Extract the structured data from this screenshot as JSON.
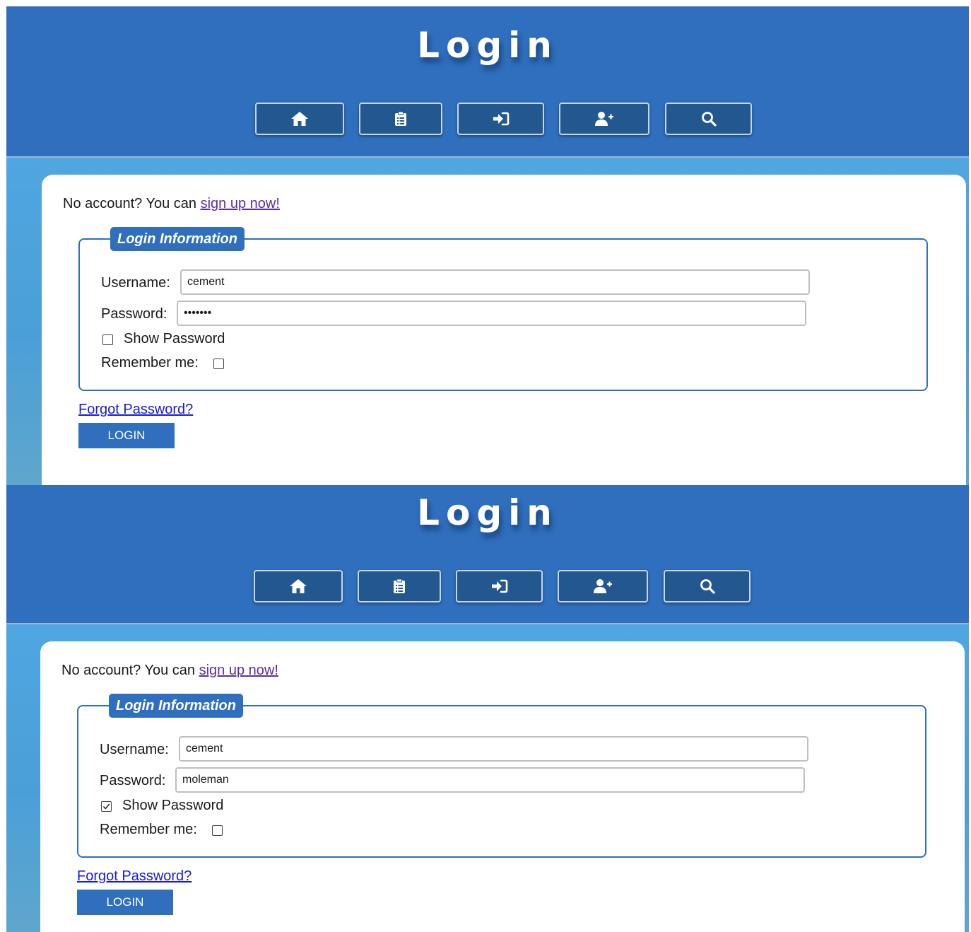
{
  "header": {
    "title": "Login",
    "nav": [
      {
        "icon": "home-icon",
        "label": ""
      },
      {
        "icon": "clipboard-icon",
        "label": ""
      },
      {
        "icon": "sign-in-icon",
        "label": ""
      },
      {
        "icon": "user-plus-icon",
        "label": ""
      },
      {
        "icon": "search-icon",
        "label": ""
      }
    ]
  },
  "colors": {
    "header_bg": "#2f6fbd",
    "nav_button_bg": "#22578f",
    "body_bg": "#4fa6e0",
    "accent": "#2f6fbd",
    "visited_link": "#5a2fa0",
    "link": "#1a1ad8"
  },
  "panels": [
    {
      "intro_text": "No account? You can ",
      "signup_link": "sign up now!",
      "legend": "Login Information",
      "username_label": "Username:",
      "username_value": "cement",
      "password_label": "Password:",
      "password_value": "•••••••",
      "show_password_label": "Show Password",
      "show_password_checked": false,
      "remember_label": "Remember me:",
      "remember_checked": false,
      "forgot_link": "Forgot Password?",
      "login_button": "LOGIN"
    },
    {
      "intro_text": "No account? You can ",
      "signup_link": "sign up now!",
      "legend": "Login Information",
      "username_label": "Username:",
      "username_value": "cement",
      "password_label": "Password:",
      "password_value": "moleman",
      "show_password_label": "Show Password",
      "show_password_checked": true,
      "remember_label": "Remember me:",
      "remember_checked": false,
      "forgot_link": "Forgot Password?",
      "login_button": "LOGIN"
    }
  ]
}
